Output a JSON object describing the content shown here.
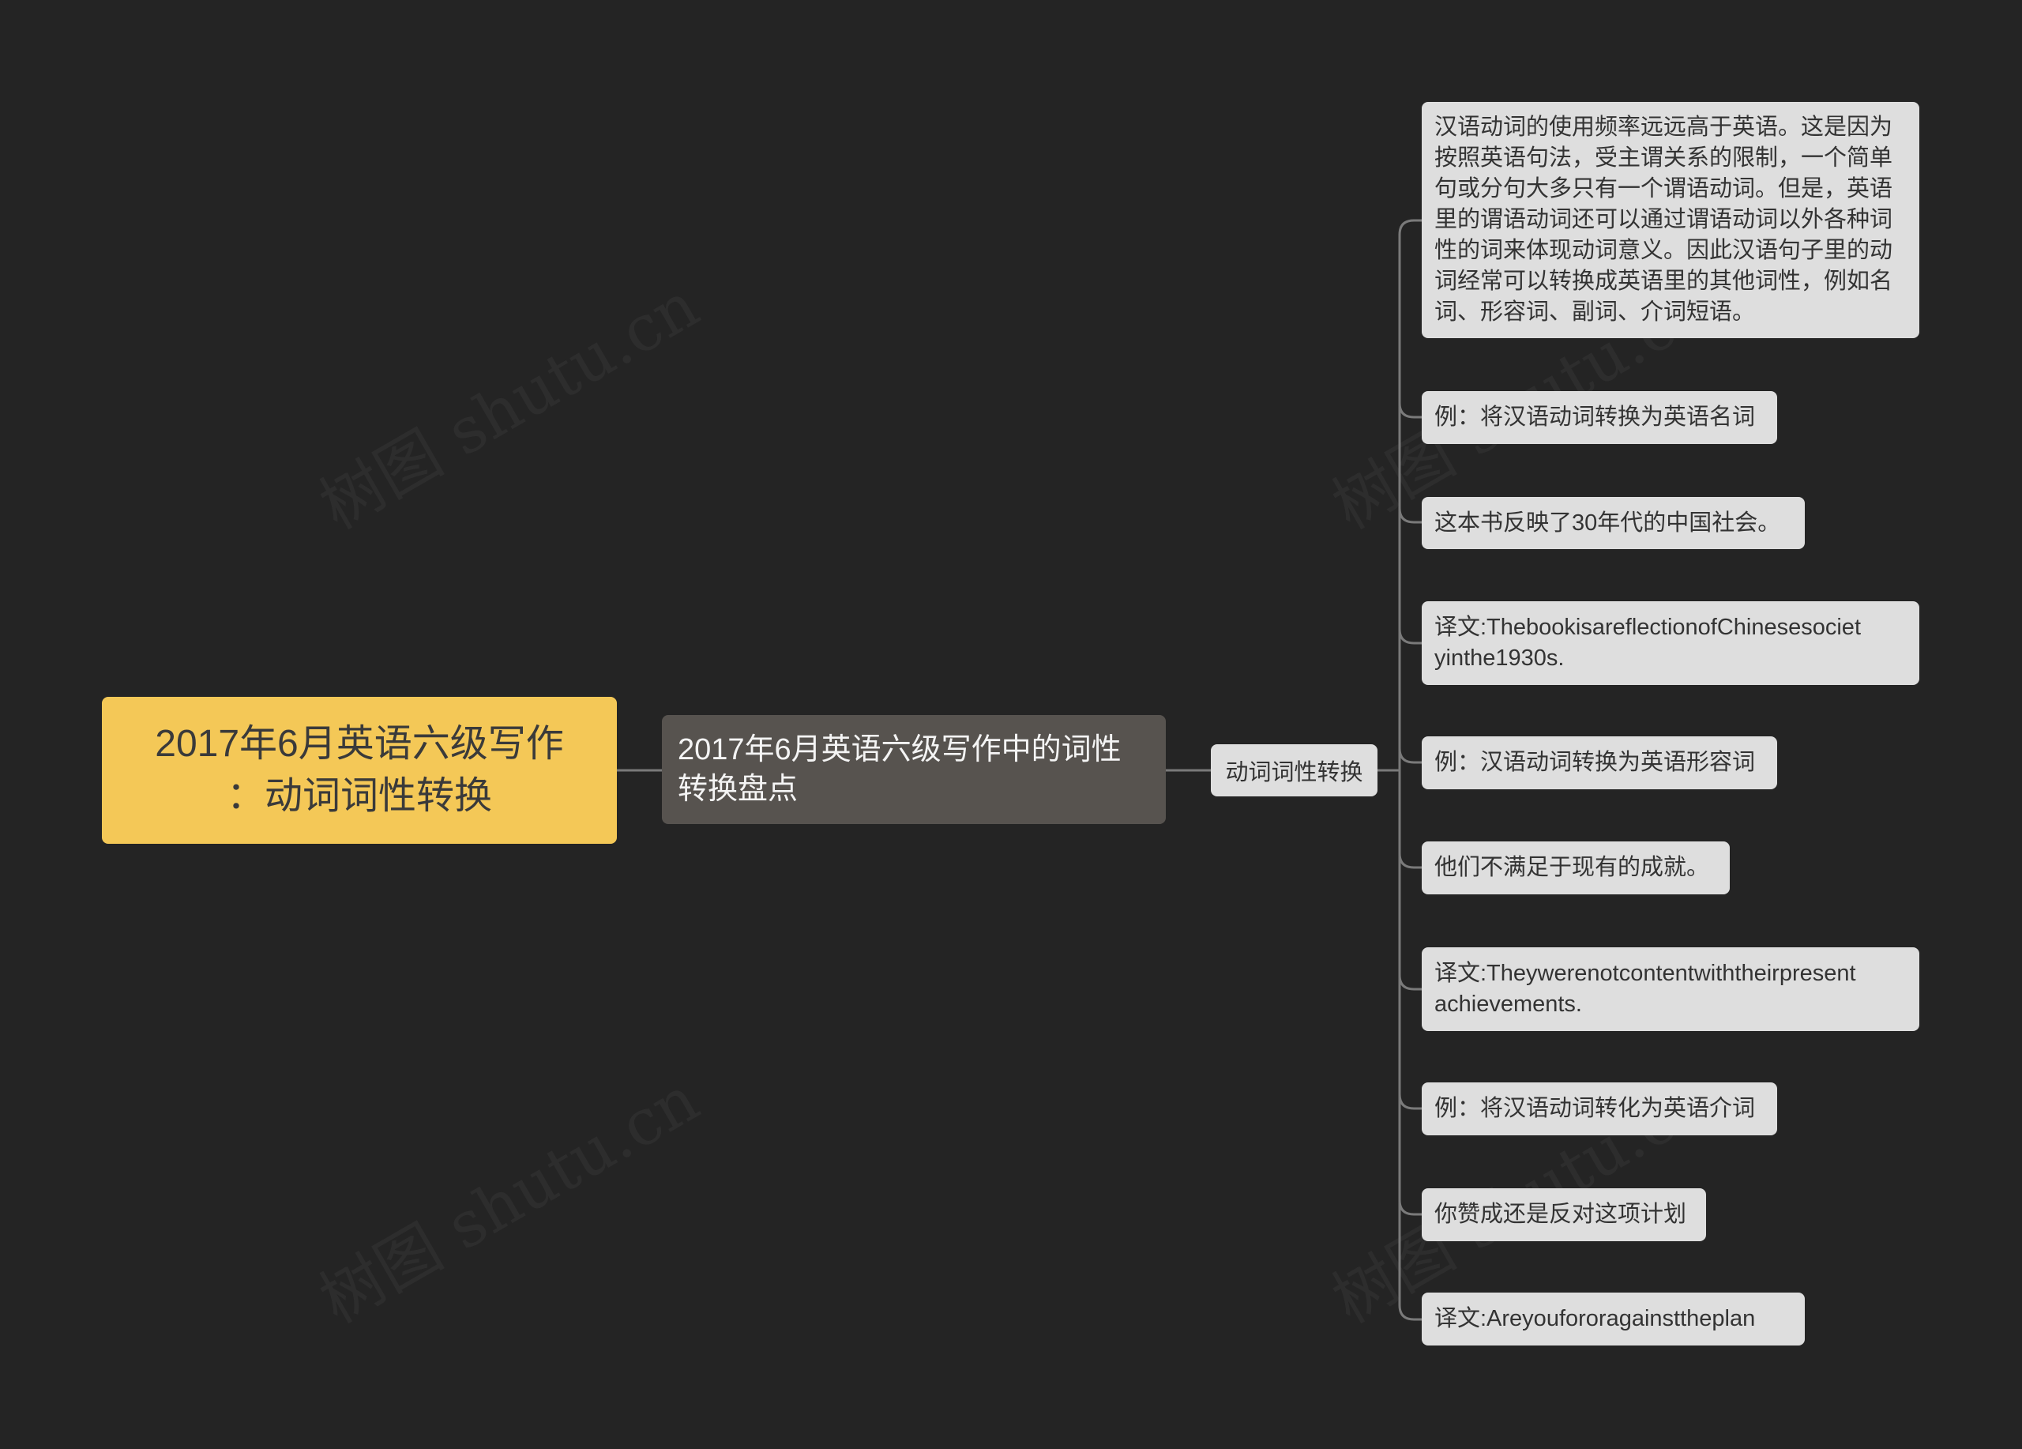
{
  "watermark": "树图 shutu.cn",
  "colors": {
    "background": "#242424",
    "root_fill": "#f4c857",
    "branch_fill": "#57534f",
    "node_fill": "#dedede",
    "connector": "#7a7a7a"
  },
  "root": {
    "lines": [
      "2017年6月英语六级写作",
      "：动词词性转换"
    ]
  },
  "branch": {
    "lines": [
      "2017年6月英语六级写作中的词性",
      "转换盘点"
    ]
  },
  "subtopic": {
    "label": "动词词性转换"
  },
  "leaves": [
    {
      "lines": [
        "汉语动词的使用频率远远高于英语。这是因为",
        "按照英语句法，受主谓关系的限制，一个简单",
        "句或分句大多只有一个谓语动词。但是，英语",
        "里的谓语动词还可以通过谓语动词以外各种词",
        "性的词来体现动词意义。因此汉语句子里的动",
        "词经常可以转换成英语里的其他词性，例如名",
        "词、形容词、副词、介词短语。"
      ]
    },
    {
      "lines": [
        "例：将汉语动词转换为英语名词"
      ]
    },
    {
      "lines": [
        "这本书反映了30年代的中国社会。"
      ]
    },
    {
      "lines": [
        "译文:ThebookisareflectionofChinesesociet",
        "yinthe1930s."
      ]
    },
    {
      "lines": [
        "例：汉语动词转换为英语形容词"
      ]
    },
    {
      "lines": [
        "他们不满足于现有的成就。"
      ]
    },
    {
      "lines": [
        "译文:Theywerenotcontentwiththeirpresent",
        "achievements."
      ]
    },
    {
      "lines": [
        "例：将汉语动词转化为英语介词"
      ]
    },
    {
      "lines": [
        "你赞成还是反对这项计划"
      ]
    },
    {
      "lines": [
        "译文:Areyoufororagainsttheplan"
      ]
    }
  ]
}
